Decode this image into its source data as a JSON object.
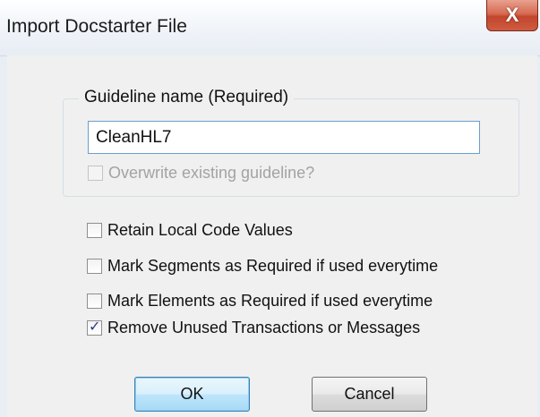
{
  "window": {
    "title": "Import Docstarter File",
    "close_symbol": "X"
  },
  "group": {
    "legend": "Guideline name (Required)",
    "name_value": "CleanHL7",
    "overwrite_label": "Overwrite existing guideline?",
    "overwrite_checked": false,
    "overwrite_enabled": false
  },
  "options": [
    {
      "label": "Retain Local Code Values",
      "checked": false
    },
    {
      "label": "Mark Segments as Required if used everytime",
      "checked": false
    },
    {
      "label": "Mark Elements as Required if used everytime",
      "checked": false
    },
    {
      "label": "Remove Unused Transactions or Messages",
      "checked": true
    }
  ],
  "buttons": {
    "ok_label": "OK",
    "cancel_label": "Cancel"
  }
}
